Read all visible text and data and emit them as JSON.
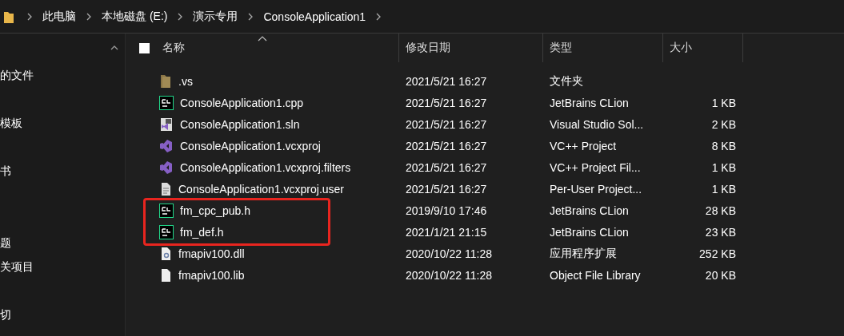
{
  "breadcrumb": [
    "此电脑",
    "本地磁盘 (E:)",
    "演示专用",
    "ConsoleApplication1"
  ],
  "sidebar": {
    "items": [
      "的文件",
      "模板",
      "书",
      "题",
      "关项目",
      "切"
    ]
  },
  "table": {
    "select_all": {
      "checked": false
    },
    "columns": [
      {
        "label": "名称",
        "sorted": true
      },
      {
        "label": "修改日期",
        "sorted": false
      },
      {
        "label": "类型",
        "sorted": false
      },
      {
        "label": "大小",
        "sorted": false
      }
    ],
    "rows": [
      {
        "kind": "folder",
        "name": ".vs",
        "date": "2021/5/21 16:27",
        "type": "文件夹",
        "size": "",
        "highlighted": false
      },
      {
        "kind": "clion",
        "name": "ConsoleApplication1.cpp",
        "date": "2021/5/21 16:27",
        "type": "JetBrains CLion",
        "size": "1 KB",
        "highlighted": false
      },
      {
        "kind": "sln",
        "name": "ConsoleApplication1.sln",
        "date": "2021/5/21 16:27",
        "type": "Visual Studio Sol...",
        "size": "2 KB",
        "highlighted": false
      },
      {
        "kind": "vs",
        "name": "ConsoleApplication1.vcxproj",
        "date": "2021/5/21 16:27",
        "type": "VC++ Project",
        "size": "8 KB",
        "highlighted": false
      },
      {
        "kind": "vs",
        "name": "ConsoleApplication1.vcxproj.filters",
        "date": "2021/5/21 16:27",
        "type": "VC++ Project Fil...",
        "size": "1 KB",
        "highlighted": false
      },
      {
        "kind": "doc",
        "name": "ConsoleApplication1.vcxproj.user",
        "date": "2021/5/21 16:27",
        "type": "Per-User Project...",
        "size": "1 KB",
        "highlighted": false
      },
      {
        "kind": "clion",
        "name": "fm_cpc_pub.h",
        "date": "2019/9/10 17:46",
        "type": "JetBrains CLion",
        "size": "28 KB",
        "highlighted": true
      },
      {
        "kind": "clion",
        "name": "fm_def.h",
        "date": "2021/1/21 21:15",
        "type": "JetBrains CLion",
        "size": "23 KB",
        "highlighted": true
      },
      {
        "kind": "dll",
        "name": "fmapiv100.dll",
        "date": "2020/10/22 11:28",
        "type": "应用程序扩展",
        "size": "252 KB",
        "highlighted": false
      },
      {
        "kind": "file",
        "name": "fmapiv100.lib",
        "date": "2020/10/22 11:28",
        "type": "Object File Library",
        "size": "20 KB",
        "highlighted": false
      }
    ]
  }
}
